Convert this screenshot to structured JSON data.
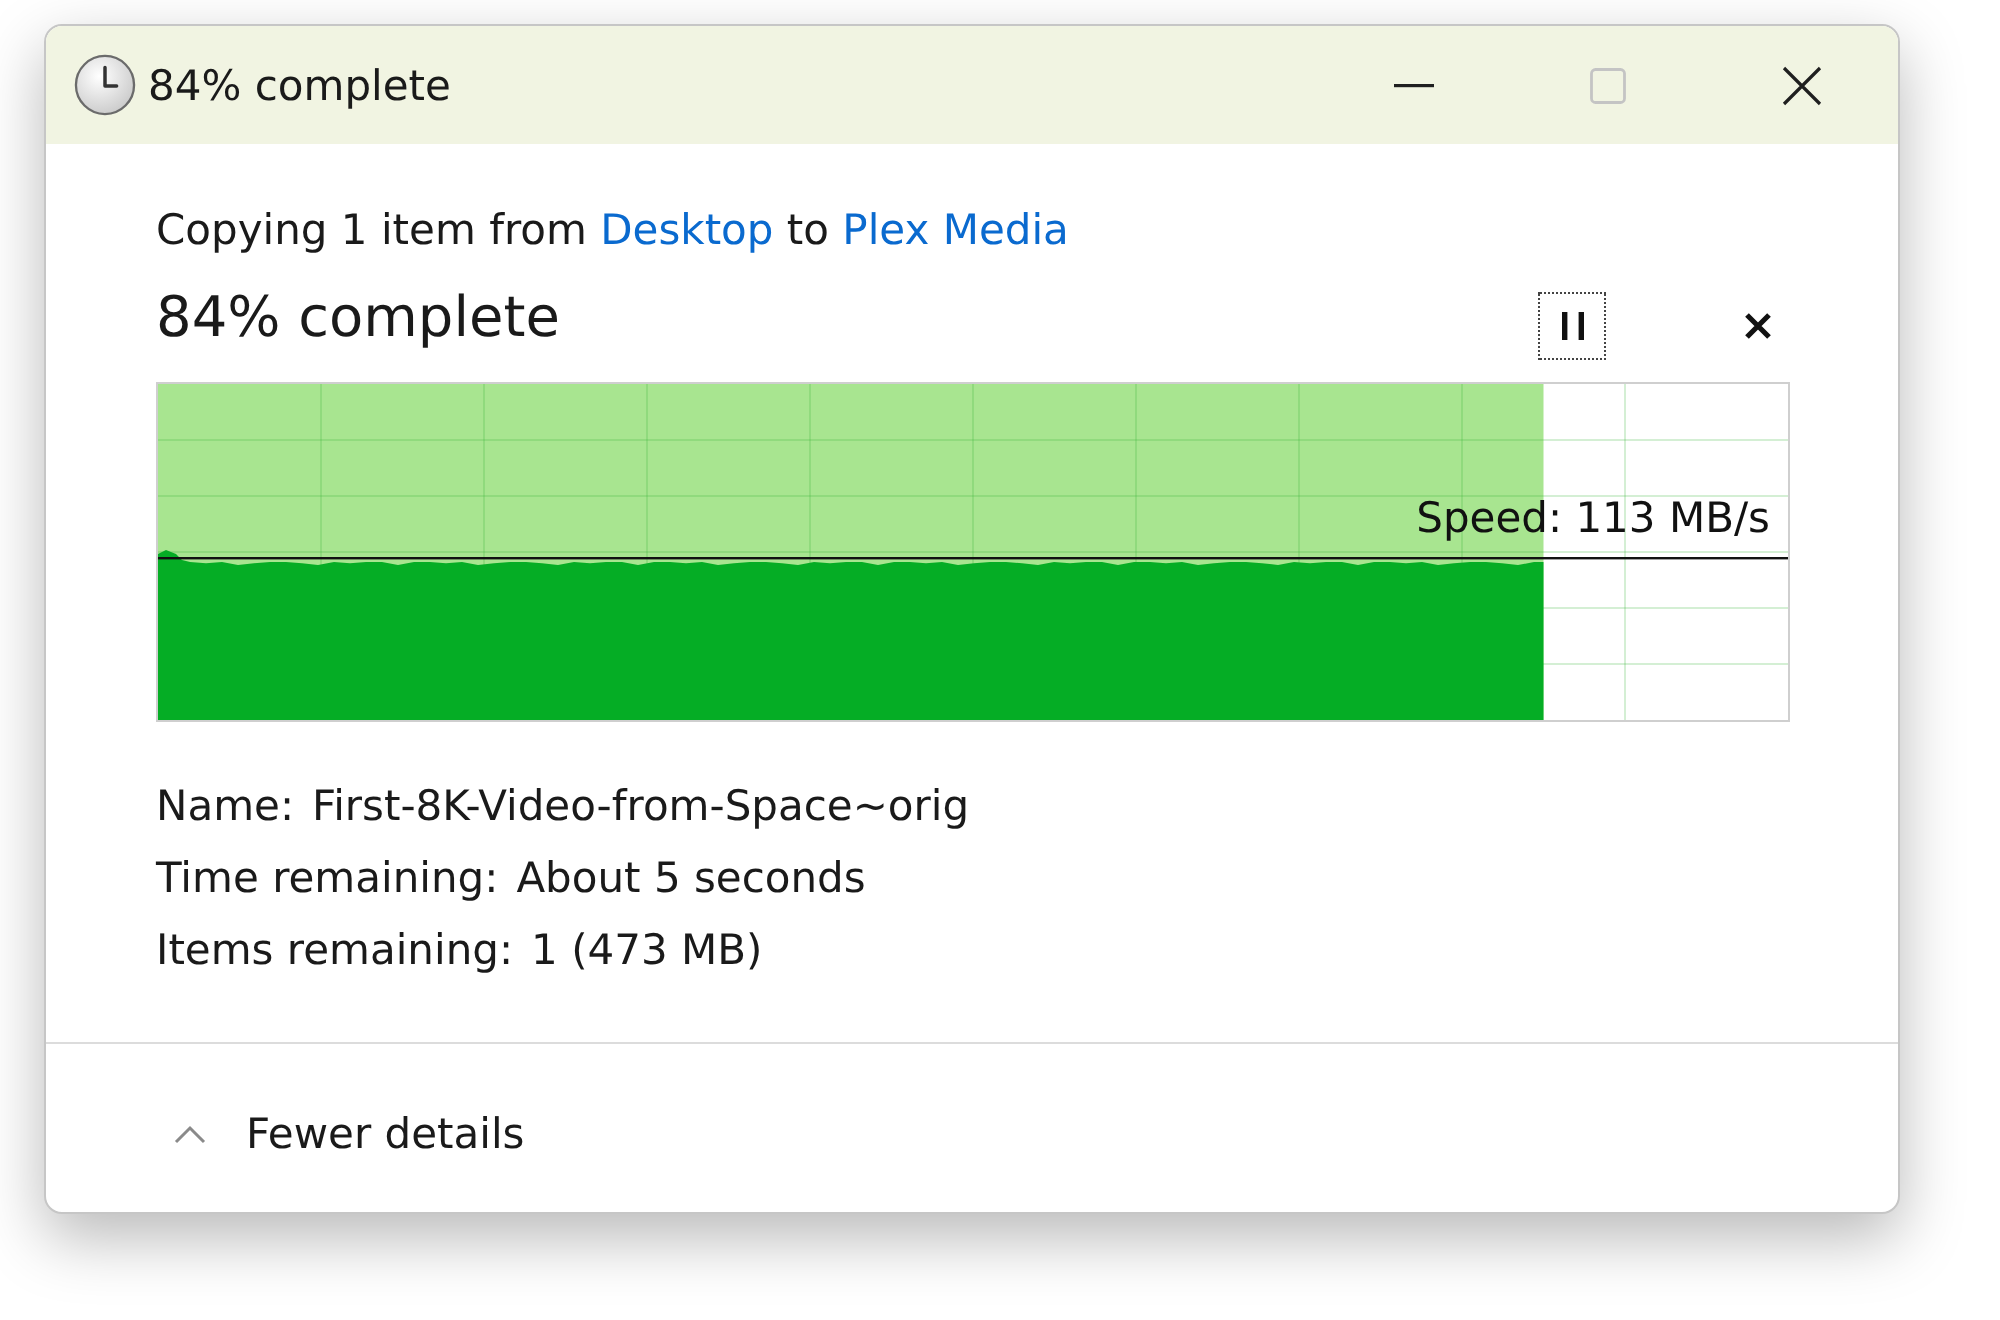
{
  "window": {
    "title": "84% complete",
    "controls": [
      {
        "kind": "minimize",
        "disabled": false
      },
      {
        "kind": "maximize",
        "disabled": true
      },
      {
        "kind": "close",
        "disabled": false
      }
    ]
  },
  "summary": {
    "prefix": "Copying 1 item from",
    "source": "Desktop",
    "joiner": "to",
    "destination": "Plex Media"
  },
  "progress": {
    "heading": "84% complete",
    "level": 0.85,
    "speed": "Speed: 113 MB/s",
    "buttons": [
      {
        "kind": "pause",
        "focused": true
      },
      {
        "kind": "cancel",
        "focused": false
      }
    ]
  },
  "details": [
    {
      "label": "Name:",
      "value": "First-8K-Video-from-Space~orig"
    },
    {
      "label": "Time remaining:",
      "value": "About 5 seconds"
    },
    {
      "label": "Items remaining:",
      "value": "1 (473 MB)"
    }
  ],
  "footer": {
    "toggle": "Fewer details",
    "expanded": true
  }
}
